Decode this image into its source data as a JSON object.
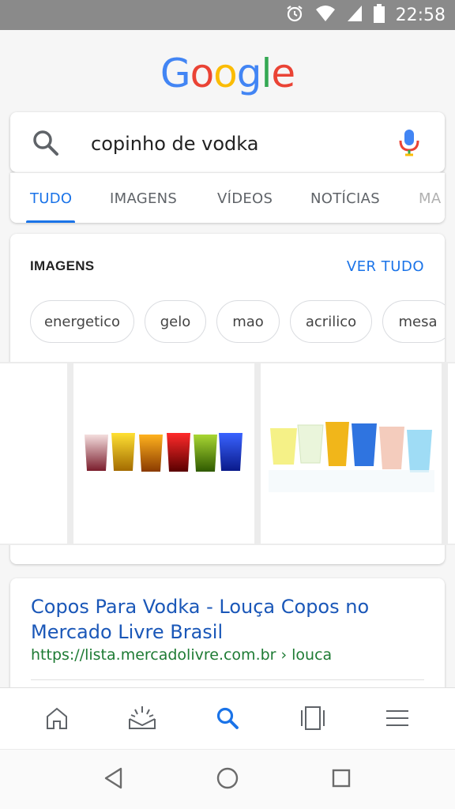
{
  "status_bar": {
    "time": "22:58",
    "icons": [
      "alarm-icon",
      "wifi-icon",
      "signal-icon",
      "battery-icon"
    ]
  },
  "logo": {
    "letters": [
      "G",
      "o",
      "o",
      "g",
      "l",
      "e"
    ],
    "colors": [
      "#4285F4",
      "#EA4335",
      "#FBBC05",
      "#4285F4",
      "#34A853",
      "#EA4335"
    ]
  },
  "search": {
    "query": "copinho de vodka"
  },
  "tabs": [
    "TUDO",
    "IMAGENS",
    "VÍDEOS",
    "NOTÍCIAS",
    "MA"
  ],
  "images_section": {
    "title": "IMAGENS",
    "see_all": "VER TUDO",
    "chips": [
      "energetico",
      "gelo",
      "mao",
      "acrilico",
      "mesa"
    ]
  },
  "result": {
    "title": "Copos Para Vodka - Louça Copos no Mercado Livre Brasil",
    "url": "https://lista.mercadolivre.com.br › louca"
  },
  "bottom_nav": [
    "home-icon",
    "updates-icon",
    "search-icon",
    "tabs-icon",
    "menu-icon"
  ],
  "system_nav": [
    "back-icon",
    "home-circle-icon",
    "recents-icon"
  ],
  "colors": {
    "accent": "#1a73e8",
    "link": "#1a57b8",
    "url_green": "#1e7b34",
    "status_bar": "#8a8a8a"
  }
}
